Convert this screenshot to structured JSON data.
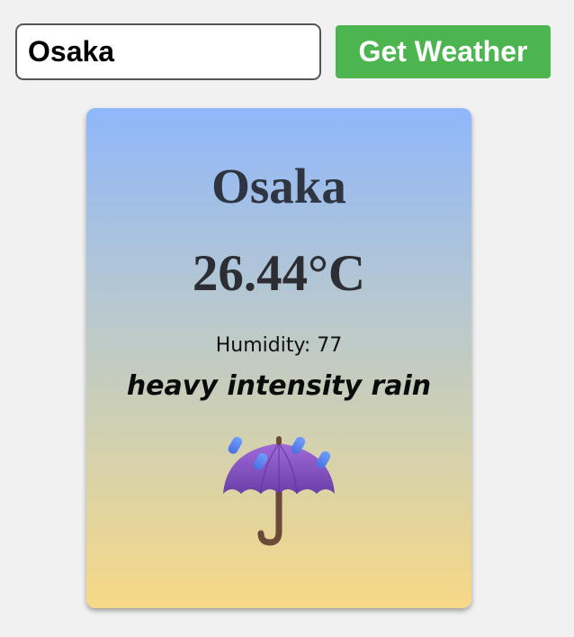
{
  "search": {
    "input_value": "Osaka",
    "button_label": "Get Weather"
  },
  "weather": {
    "city": "Osaka",
    "temperature": "26.44°C",
    "humidity_text": "Humidity: 77",
    "description": "heavy intensity rain",
    "icon": "umbrella-with-rain-icon"
  },
  "colors": {
    "page_background": "#f1f1f1",
    "button_green": "#4cb550",
    "card_gradient_top": "#8fb7fb",
    "card_gradient_bottom": "#f7d886"
  }
}
